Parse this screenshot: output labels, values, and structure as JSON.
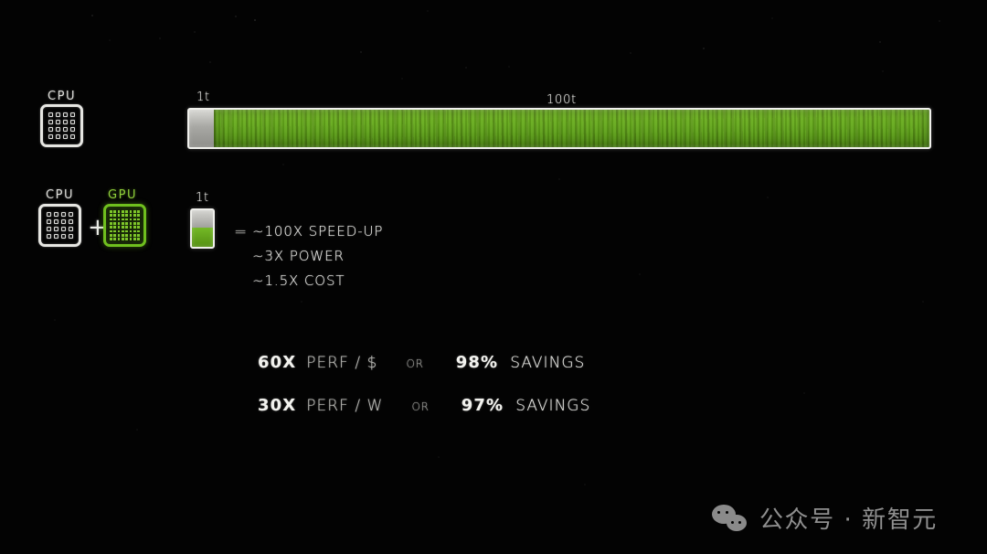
{
  "slide": {
    "background_color": "#030303",
    "chalk_color": "#e8e8e4",
    "accent_green": "#76b82a",
    "gray_color": "#a8a8a4"
  },
  "row_cpu": {
    "chip_label": "CPU",
    "bar_start_label": "1t",
    "bar_end_label": "100t"
  },
  "row_gpu": {
    "cpu_label": "CPU",
    "plus_symbol": "+",
    "gpu_label": "GPU",
    "bar_label": "1t",
    "equals_symbol": "=",
    "results": [
      "~100X SPEED-UP",
      "~3X POWER",
      "~1.5X COST"
    ]
  },
  "savings": [
    {
      "metric_value": "60X",
      "metric_unit": "PERF / $",
      "conjunction": "OR",
      "savings_value": "98%",
      "savings_label": "SAVINGS"
    },
    {
      "metric_value": "30X",
      "metric_unit": "PERF / W",
      "conjunction": "OR",
      "savings_value": "97%",
      "savings_label": "SAVINGS"
    }
  ],
  "watermark": {
    "icon": "wechat-icon",
    "text": "公众号 · 新智元"
  }
}
